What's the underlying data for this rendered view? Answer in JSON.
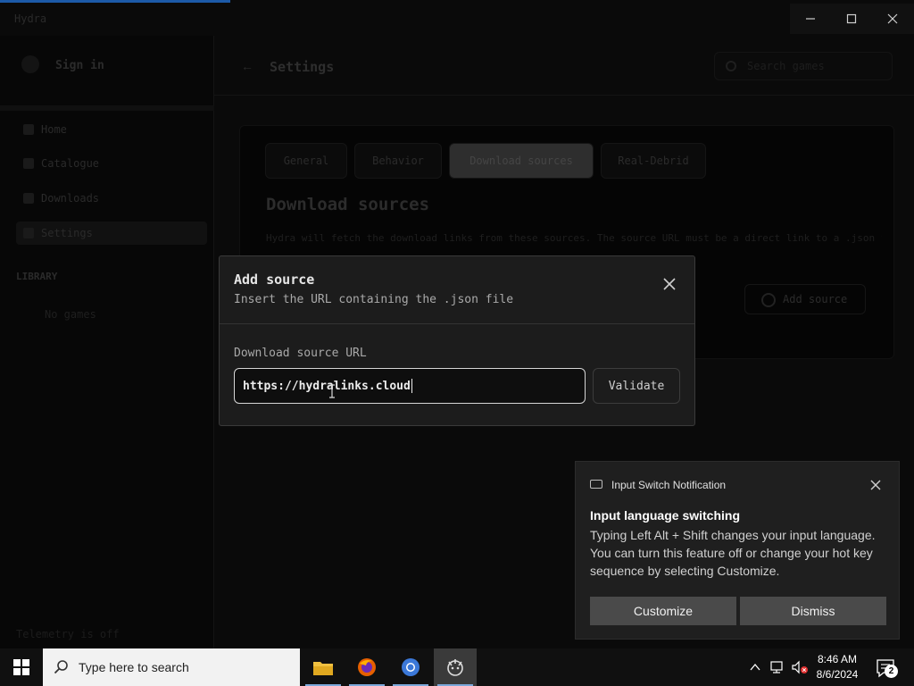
{
  "app": {
    "title": "Hydra",
    "sidebar": {
      "signin": "Sign in",
      "items": [
        "Home",
        "Catalogue",
        "Downloads",
        "Settings"
      ],
      "library_label": "LIBRARY",
      "library_empty": "No games",
      "footer": "Telemetry is off"
    },
    "header": {
      "title": "Settings",
      "search_placeholder": "Search games"
    },
    "settings": {
      "tabs": [
        "General",
        "Behavior",
        "Download sources",
        "Real-Debrid"
      ],
      "active_tab": "Download sources",
      "section_title": "Download sources",
      "section_desc": "Hydra will fetch the download links from these sources. The source URL must be a direct link to a .json file containing the download links.",
      "add_source_label": "Add source"
    }
  },
  "modal": {
    "title": "Add source",
    "subtitle": "Insert the URL containing the .json file",
    "url_label": "Download source URL",
    "url_value": "https://hydralinks.cloud",
    "validate_label": "Validate"
  },
  "toast": {
    "app_name": "Input Switch Notification",
    "heading": "Input language switching",
    "body": "Typing Left Alt + Shift changes your input language. You can turn this feature off or change your hot key sequence by selecting Customize.",
    "customize_label": "Customize",
    "dismiss_label": "Dismiss"
  },
  "taskbar": {
    "search_placeholder": "Type here to search",
    "time": "8:46 AM",
    "date": "8/6/2024",
    "notification_count": "2"
  },
  "colors": {
    "accent_loading": "#1c5aa8",
    "modal_bg": "#1c1c1c",
    "toast_bg": "#1f1f1f",
    "taskbar_bg": "#101010"
  }
}
